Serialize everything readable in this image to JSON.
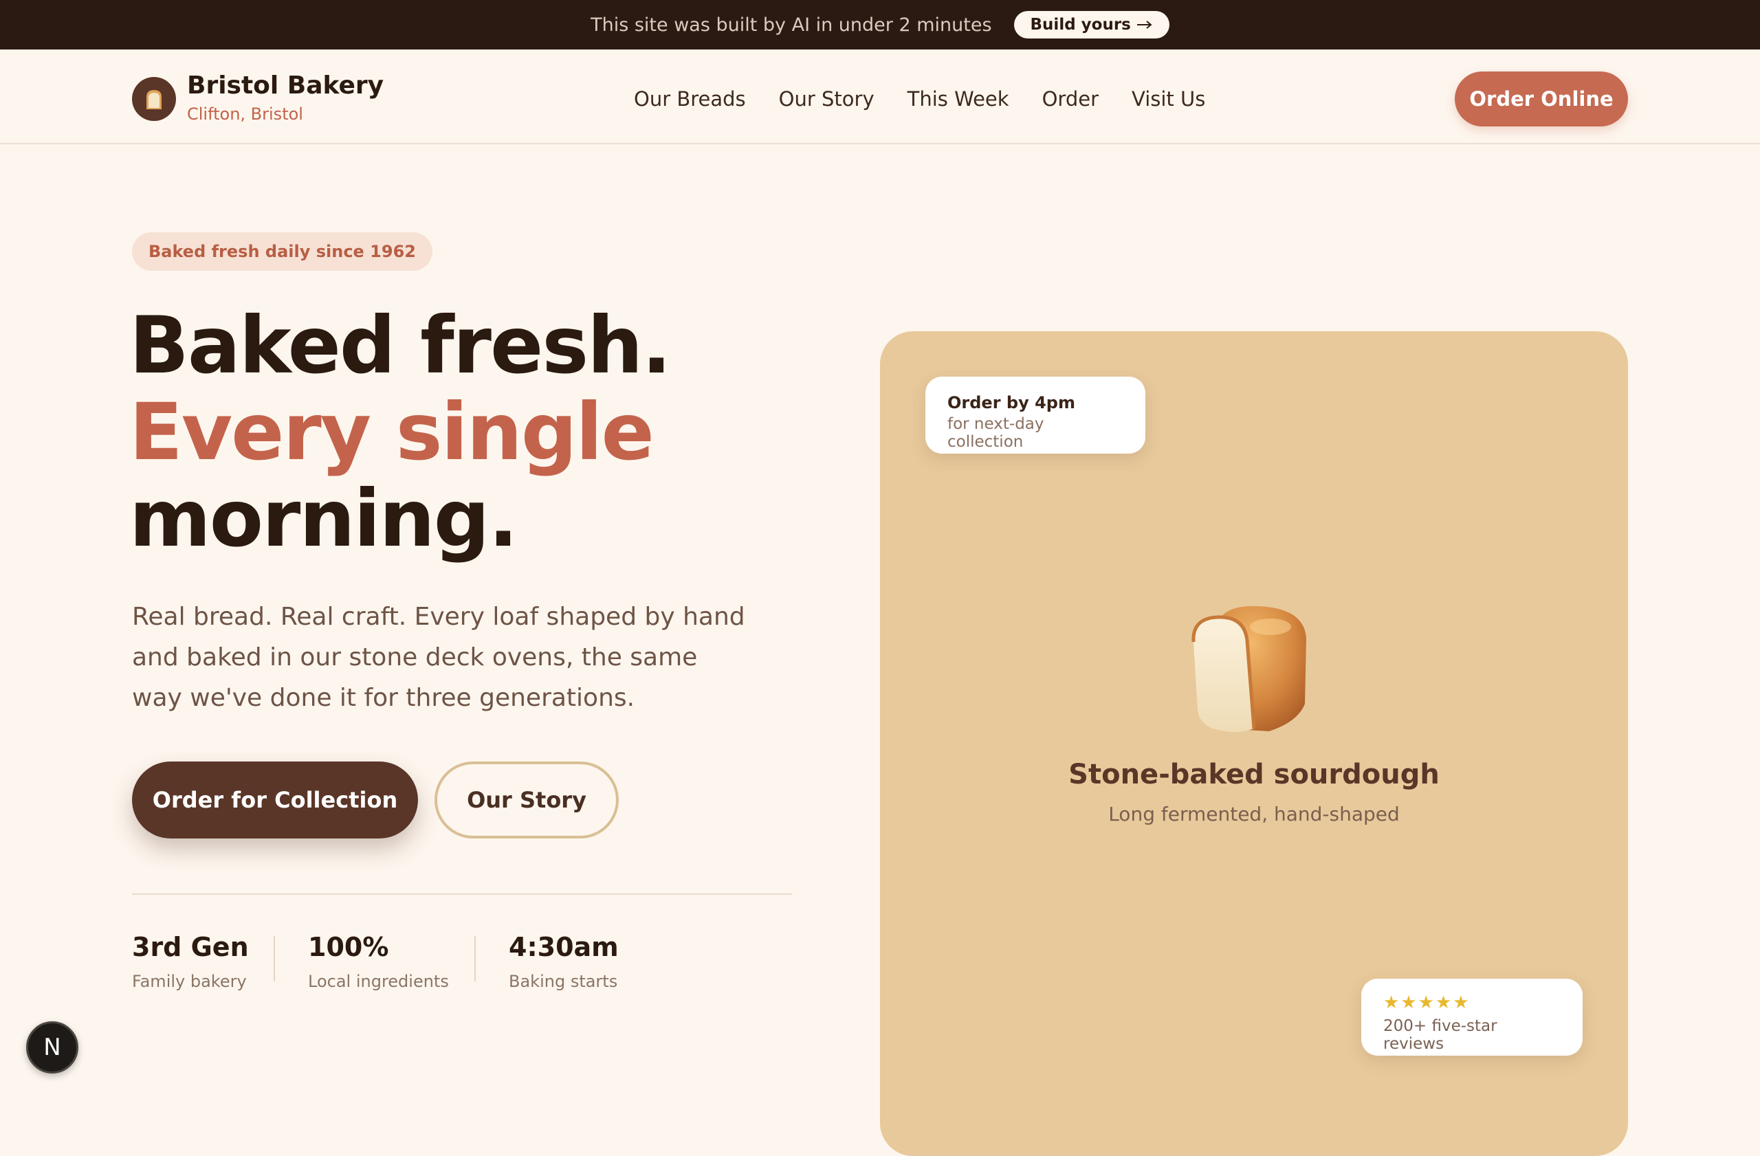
{
  "banner": {
    "text": "This site was built by AI in under 2 minutes",
    "button": "Build yours",
    "button_icon": "arrow-right-icon"
  },
  "header": {
    "brand": "Bristol Bakery",
    "location": "Clifton, Bristol",
    "logo_icon": "bread-icon",
    "nav": [
      "Our Breads",
      "Our Story",
      "This Week",
      "Order",
      "Visit Us"
    ],
    "cta": "Order Online"
  },
  "hero": {
    "badge": "Baked fresh daily since 1962",
    "headline": {
      "line1": "Baked fresh.",
      "line2": "Every single",
      "line3": "morning."
    },
    "lead": "Real bread. Real craft. Every loaf shaped by hand and baked in our stone deck ovens, the same way we've done it for three generations.",
    "primary_button": "Order for Collection",
    "secondary_button": "Our Story",
    "stats": [
      {
        "value": "3rd Gen",
        "label": "Family bakery"
      },
      {
        "value": "100%",
        "label": "Local ingredients"
      },
      {
        "value": "4:30am",
        "label": "Baking starts"
      }
    ]
  },
  "feature_card": {
    "title": "Stone-baked sourdough",
    "subtitle": "Long fermented, hand-shaped",
    "image_icon": "bread-loaf-icon",
    "order_note": {
      "title": "Order by 4pm",
      "subtitle": "for next-day collection"
    },
    "reviews": {
      "stars": "★★★★★",
      "rating": 5,
      "text": "200+ five-star reviews"
    }
  },
  "floating_badge": {
    "letter": "N"
  },
  "colors": {
    "background": "#fdf6ee",
    "banner": "#2b1a12",
    "accent": "#c66a52",
    "primary_dark": "#5a3628",
    "card": "#e8c99b"
  }
}
